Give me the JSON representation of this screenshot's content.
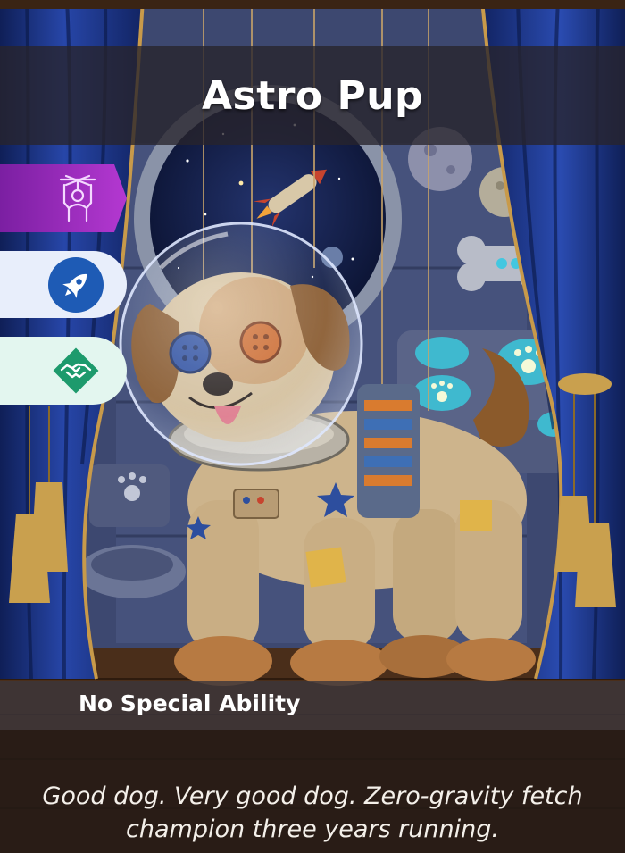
{
  "card": {
    "title": "Astro Pup",
    "ability_title": "No Special Ability",
    "flavor_text": "Good dog. Very good dog. Zero-gravity fetch champion three years running."
  },
  "side_badges": [
    {
      "icon": "puppet-icon",
      "color": "#9c27b0"
    },
    {
      "icon": "rocket-icon",
      "color": "#1e5bb5"
    },
    {
      "icon": "handshake-icon",
      "color": "#1d9a6c"
    }
  ],
  "colors": {
    "curtain": "#1f3a8a",
    "title_band": "#28242c",
    "accent_purple": "#9c27b0",
    "accent_blue": "#1e5bb5",
    "accent_green": "#1d9a6c"
  }
}
